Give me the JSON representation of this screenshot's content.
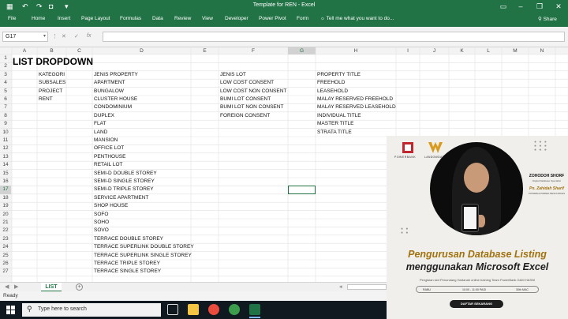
{
  "window": {
    "title": "Template for REN - Excel"
  },
  "ribbon": {
    "tabs": [
      "File",
      "Home",
      "Insert",
      "Page Layout",
      "Formulas",
      "Data",
      "Review",
      "View",
      "Developer",
      "Power Pivot",
      "Form"
    ],
    "tell_me": "Tell me what you want to do...",
    "share": "Share"
  },
  "formula_bar": {
    "name_box": "G17",
    "formula": ""
  },
  "columns": [
    "A",
    "B",
    "C",
    "D",
    "E",
    "F",
    "G",
    "H",
    "I",
    "J",
    "K",
    "L",
    "M",
    "N"
  ],
  "rows": [
    "1",
    "2",
    "3",
    "4",
    "5",
    "6",
    "7",
    "8",
    "9",
    "10",
    "11",
    "12",
    "13",
    "14",
    "15",
    "16",
    "17",
    "18",
    "19",
    "20",
    "21",
    "22",
    "23",
    "24",
    "25",
    "26",
    "27"
  ],
  "sheet": {
    "title": "LIST DROPDOWN",
    "kategori": [
      "KATEGORI",
      "SUBSALES",
      "PROJECT",
      "RENT"
    ],
    "jenis_property": [
      "JENIS PROPERTY",
      "APARTMENT",
      "BUNGALOW",
      "CLUSTER HOUSE",
      "CONDOMINIUM",
      "DUPLEX",
      "FLAT",
      "LAND",
      "MANSION",
      "OFFICE LOT",
      "PENTHOUSE",
      "RETAIL LOT",
      "SEMI-D DOUBLE STOREY",
      "SEMI-D SINGLE STOREY",
      "SEMI-D TRIPLE STOREY",
      "SERVICE APARTMENT",
      "SHOP HOUSE",
      "SOFO",
      "SOHO",
      "SOVO",
      "TERRACE DOUBLE STOREY",
      "TERRACE SUPERLINK DOUBLE STOREY",
      "TERRACE SUPERLINK SINGLE STOREY",
      "TERRACE TRIPLE STOREY",
      "TERRACE SINGLE STOREY"
    ],
    "jenis_lot": [
      "JENIS LOT",
      "LOW COST CONSENT",
      "LOW COST NON CONSENT",
      "BUMI LOT CONSENT",
      "BUMI LOT NON CONSENT",
      "FOREIGN CONSENT"
    ],
    "property_title": [
      "PROPERTY TITLE",
      "FREEHOLD",
      "LEASEHOLD",
      "MALAY RESERVED FREEHOLD",
      "MALAY RESERVED LEASEHOLD",
      "INDIVIDUAL TITLE",
      "MASTER TITLE",
      "STRATA TITLE"
    ]
  },
  "sheet_tabs": [
    "LIST"
  ],
  "status": "Ready",
  "taskbar": {
    "search_placeholder": "Type here to search"
  },
  "promo": {
    "brand1": "POWERBANK",
    "brand2": "LANDOWDATH",
    "speaker_name": "ZOHODOH SHORF",
    "speaker_role": "Digital Database Specialist",
    "host_name": "Pn. Zahidah Sharif",
    "host_role": "POWERHUNDRED RESOURCES",
    "headline1": "Pengurusan Database Listing",
    "headline2": "menggunakan Microsoft Excel",
    "subtitle": "Pengisian slot Penundang Hartanah online training Team PowerBank GAM HASNI",
    "day": "RABU",
    "time": "10:00 - 11:00 PAGI",
    "date": "30th MAC",
    "cta": "DAFTAR SEKARANG"
  },
  "colors": {
    "excel_green": "#217346",
    "promo_gold": "#a0720e"
  }
}
